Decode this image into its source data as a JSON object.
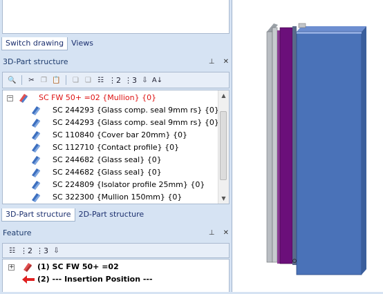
{
  "top_tabs": {
    "switch_drawing": "Switch drawing",
    "views": "Views"
  },
  "part_panel": {
    "title": "3D-Part structure",
    "pin_icon": "pin-icon",
    "close_icon": "close-icon",
    "root": "SC  FW 50+ =02 {Mullion} {0}",
    "items": [
      "SC  244293 {Glass comp. seal 9mm rs} {0}",
      "SC  244293 {Glass comp. seal 9mm rs} {0}",
      "SC  110840 {Cover bar 20mm} {0}",
      "SC  112710 {Contact profile} {0}",
      "SC  244682 {Glass seal} {0}",
      "SC  244682 {Glass seal} {0}",
      "SC  224809 {Isolator profile 25mm} {0}",
      "SC  322300 {Mullion 150mm} {0}"
    ],
    "toolbar_nums": [
      "2",
      "3"
    ]
  },
  "part_tabs": {
    "tab_3d": "3D-Part structure",
    "tab_2d": "2D-Part structure"
  },
  "feature_panel": {
    "title": "Feature",
    "toolbar_nums": [
      "2",
      "3"
    ],
    "rows": [
      "(1) SC  FW 50+ =02",
      "(2) --- Insertion Position ---"
    ]
  },
  "colors": {
    "mullion_blue": "#4a72b8",
    "seal_purple": "#6b0f7a",
    "tree_root_red": "#dd1111",
    "arrow_red": "#e02020"
  }
}
